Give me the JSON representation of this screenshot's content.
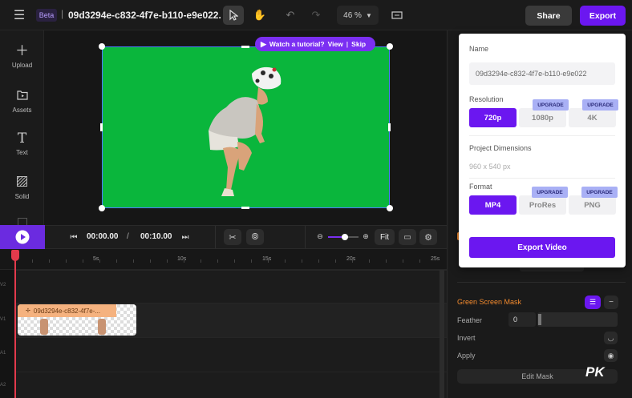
{
  "header": {
    "beta": "Beta",
    "project_title": "09d3294e-c832-4f7e-b110-e9e022...",
    "zoom": "46 %",
    "share_label": "Share",
    "export_label": "Export"
  },
  "sidebar": {
    "items": [
      {
        "label": "Upload",
        "icon": "plus-icon"
      },
      {
        "label": "Assets",
        "icon": "folder-play-icon"
      },
      {
        "label": "Text",
        "icon": "text-icon"
      },
      {
        "label": "Solid",
        "icon": "solid-icon"
      }
    ]
  },
  "tutorial": {
    "text": "Watch a tutorial?",
    "view": "View",
    "skip": "Skip"
  },
  "playback": {
    "current": "00:00.00",
    "separator": "/",
    "total": "00:10.00",
    "fit_label": "Fit",
    "volume": 0.55
  },
  "timeline": {
    "ticks": [
      "5s",
      "10s",
      "15s",
      "20s",
      "25s"
    ],
    "track_labels": [
      "V2",
      "V1",
      "A1",
      "A2"
    ],
    "clip_name": "09d3294e-c832-4f7e-..."
  },
  "export_panel": {
    "name_label": "Name",
    "name_value": "09d3294e-c832-4f7e-b110-e9e022",
    "resolution_label": "Resolution",
    "resolutions": [
      "720p",
      "1080p",
      "4K"
    ],
    "upgrade": "UPGRADE",
    "dimensions_label": "Project Dimensions",
    "dimensions_value": "960 x 540 px",
    "format_label": "Format",
    "formats": [
      "MP4",
      "ProRes",
      "PNG"
    ],
    "export_button": "Export Video"
  },
  "right_panel": {
    "green_screen": "Green Screen Mask",
    "feather_label": "Feather",
    "feather_value": "0",
    "invert_label": "Invert",
    "apply_label": "Apply",
    "edit_mask": "Edit Mask"
  },
  "watermark": "PK",
  "colors": {
    "accent": "#6b17f0",
    "green_screen": "#0ab63c",
    "orange": "#f28a2e",
    "playhead": "#e33a4c"
  }
}
